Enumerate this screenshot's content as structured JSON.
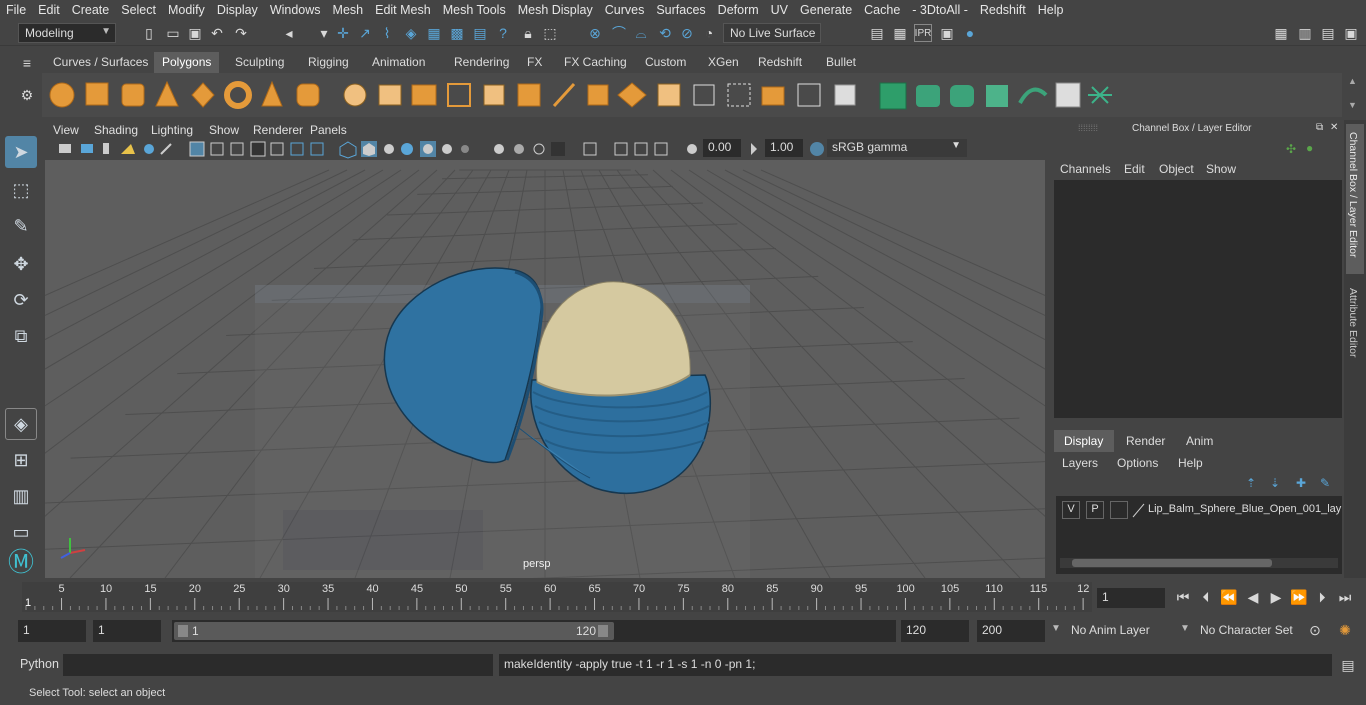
{
  "menubar": {
    "items": [
      "File",
      "Edit",
      "Create",
      "Select",
      "Modify",
      "Display",
      "Windows",
      "Mesh",
      "Edit Mesh",
      "Mesh Tools",
      "Mesh Display",
      "Curves",
      "Surfaces",
      "Deform",
      "UV",
      "Generate",
      "Cache",
      "- 3DtoAll -",
      "Redshift",
      "Help"
    ]
  },
  "statusline": {
    "workspace": "Modeling",
    "live_surface": "No Live Surface"
  },
  "shelf": {
    "tabs": [
      "Curves / Surfaces",
      "Polygons",
      "Sculpting",
      "Rigging",
      "Animation",
      "Rendering",
      "FX",
      "FX Caching",
      "Custom",
      "XGen",
      "Redshift",
      "Bullet"
    ],
    "active_tab": "Polygons"
  },
  "viewport": {
    "menus": [
      "View",
      "Shading",
      "Lighting",
      "Show",
      "Renderer",
      "Panels"
    ],
    "exposure": "0.00",
    "gamma": "1.00",
    "color_space": "sRGB gamma",
    "camera_label": "persp"
  },
  "channelbox": {
    "title": "Channel Box / Layer Editor",
    "menus": [
      "Channels",
      "Edit",
      "Object",
      "Show"
    ],
    "layer_tabs": [
      "Display",
      "Render",
      "Anim"
    ],
    "active_layer_tab": "Display",
    "layer_menus": [
      "Layers",
      "Options",
      "Help"
    ],
    "layer": {
      "v": "V",
      "p": "P",
      "name": "Lip_Balm_Sphere_Blue_Open_001_lay"
    }
  },
  "side_tabs": [
    "Channel Box / Layer Editor",
    "Attribute Editor"
  ],
  "timeline": {
    "ticks": [
      "5",
      "10",
      "15",
      "20",
      "25",
      "30",
      "35",
      "40",
      "45",
      "50",
      "55",
      "60",
      "65",
      "70",
      "75",
      "80",
      "85",
      "90",
      "95",
      "100",
      "105",
      "110",
      "115",
      "12"
    ],
    "start_mark": "1",
    "current_frame": "1"
  },
  "range": {
    "start": "1",
    "playback_start": "1",
    "slider_start": "1",
    "slider_end": "120",
    "playback_end": "120",
    "end": "200",
    "anim_layer": "No Anim Layer",
    "character_set": "No Character Set"
  },
  "cmdline": {
    "language": "Python",
    "result": "makeIdentity -apply true -t 1 -r 1 -s 1 -n 0 -pn 1;"
  },
  "helpline": {
    "text": "Select Tool: select an object"
  },
  "colors": {
    "accent": "#5285a6",
    "balm_blue": "#2e6f9e",
    "balm_cream": "#d5c9a0",
    "viewport_bg": "#5e5e5e"
  }
}
